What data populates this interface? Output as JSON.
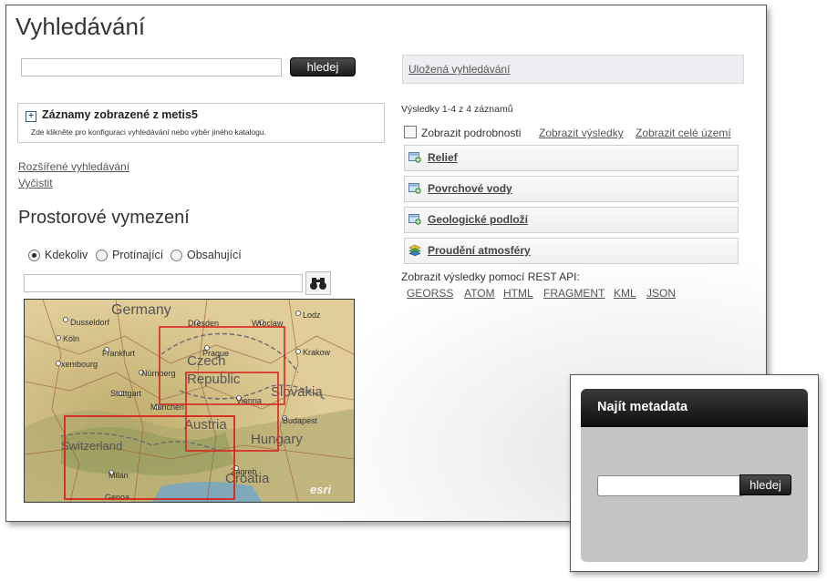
{
  "page": {
    "title": "Vyhledávání",
    "search": {
      "value": "",
      "button_label": "hledej"
    },
    "catalog": {
      "title": "Záznamy zobrazené z metis5",
      "description": "Zde klikněte pro konfiguraci vyhledávání nebo výběr jiného katalogu."
    },
    "links": {
      "advanced": "Rozšířené vyhledávání",
      "clear": "Vyčistit"
    },
    "spatial": {
      "heading": "Prostorové vymezení",
      "options": [
        "Kdekoliv",
        "Protínající",
        "Obsahující"
      ],
      "selected": "Kdekoliv",
      "location_value": ""
    },
    "map": {
      "countries": [
        "Germany",
        "Czech",
        "Republic",
        "Slovakia",
        "Austria",
        "Hungary",
        "Switzerland",
        "Croatia"
      ],
      "cities": [
        "Dusseldorf",
        "Köln",
        "Frankfurt",
        "xembourg",
        "Nürnberg",
        "Stuttgart",
        "München",
        "Dresden",
        "Wroclaw",
        "Lodz",
        "Prague",
        "Krakow",
        "Vienna",
        "Budapest",
        "Zagreb",
        "Milan",
        "Genoa"
      ],
      "logo": "esri"
    }
  },
  "results": {
    "saved_searches": "Uložená vyhledávání",
    "count_text": "Výsledky 1-4 z 4 záznamů",
    "show_details": "Zobrazit podrobnosti",
    "show_results": "Zobrazit výsledky",
    "show_all_area": "Zobrazit celé území",
    "show_details_checked": false,
    "items": [
      {
        "label": "Relief",
        "icon": "add-layer-icon"
      },
      {
        "label": "Povrchové vody",
        "icon": "add-layer-icon"
      },
      {
        "label": "Geologické podloží",
        "icon": "add-layer-icon"
      },
      {
        "label": "Proudění atmosféry",
        "icon": "layers-stack-icon"
      }
    ],
    "rest_label": "Zobrazit výsledky pomocí REST API:",
    "rest_links": [
      "GEORSS",
      "ATOM",
      "HTML",
      "FRAGMENT",
      "KML",
      "JSON"
    ]
  },
  "widget": {
    "title": "Najít metadata",
    "input_value": "",
    "button_label": "hledej"
  },
  "colors": {
    "accent_dark": "#1a1a1a",
    "map_rect": "#d8261f",
    "link": "#555555"
  }
}
